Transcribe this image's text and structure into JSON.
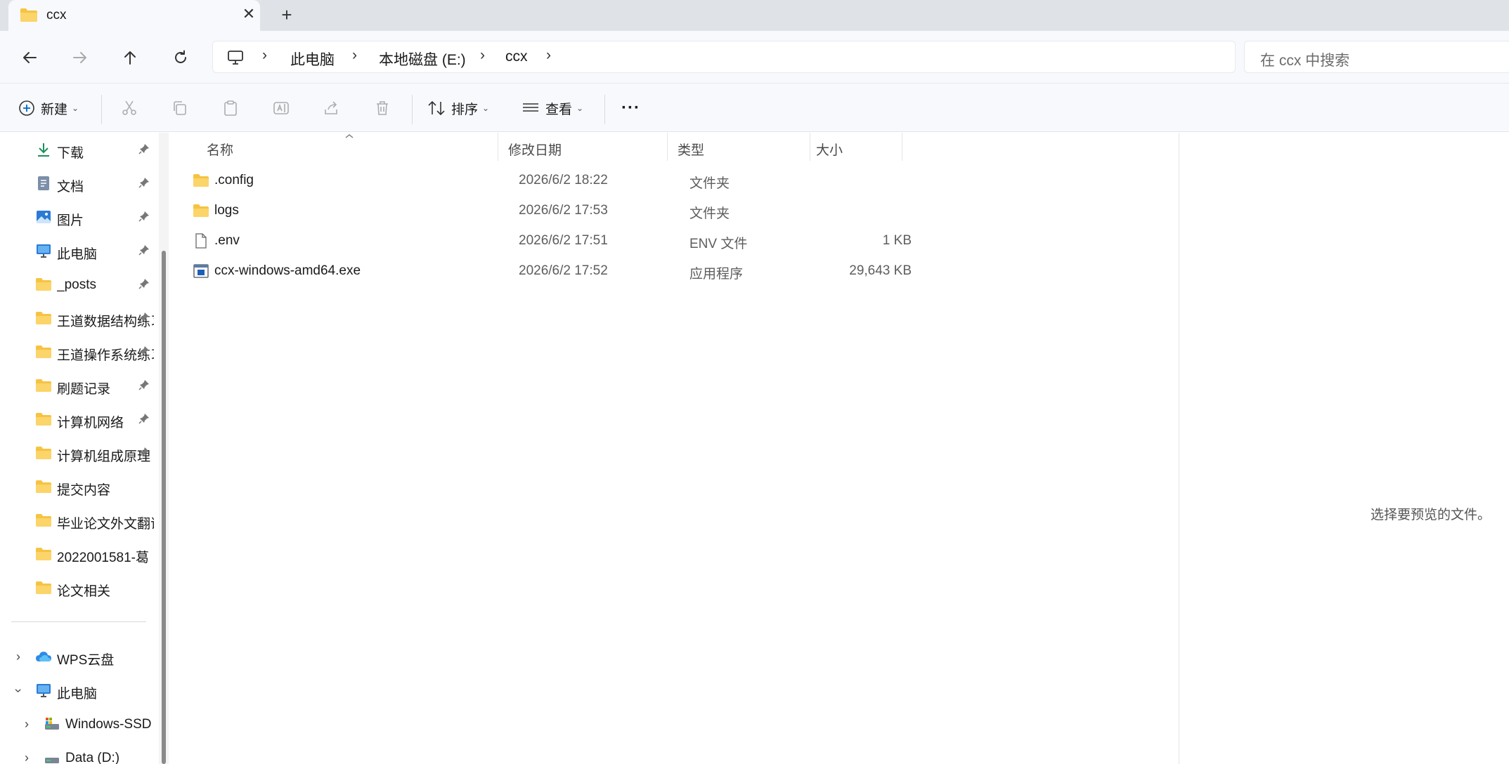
{
  "tab": {
    "title": "ccx",
    "close_glyph": "✕",
    "new_tab_glyph": "+"
  },
  "nav": {
    "back": "back-arrow-icon",
    "forward": "forward-arrow-icon",
    "up": "up-arrow-icon",
    "refresh": "refresh-icon"
  },
  "breadcrumb": {
    "items": [
      "此电脑",
      "本地磁盘 (E:)",
      "ccx"
    ]
  },
  "search": {
    "placeholder": "在 ccx 中搜索"
  },
  "toolbar": {
    "new_label": "新建",
    "sort_label": "排序",
    "view_label": "查看",
    "more_glyph": "···"
  },
  "sidebar": {
    "quick_access": [
      {
        "label": "下载",
        "icon": "download-icon",
        "pinned": true
      },
      {
        "label": "文档",
        "icon": "document-icon",
        "pinned": true
      },
      {
        "label": "图片",
        "icon": "picture-icon",
        "pinned": true
      },
      {
        "label": "此电脑",
        "icon": "computer-icon",
        "pinned": true
      },
      {
        "label": "_posts",
        "icon": "folder-icon",
        "pinned": true
      },
      {
        "label": "王道数据结构练习",
        "icon": "folder-icon",
        "pinned": true
      },
      {
        "label": "王道操作系统练习",
        "icon": "folder-icon",
        "pinned": true
      },
      {
        "label": "刷题记录",
        "icon": "folder-icon",
        "pinned": true
      },
      {
        "label": "计算机网络",
        "icon": "folder-icon",
        "pinned": true
      },
      {
        "label": "计算机组成原理",
        "icon": "folder-icon",
        "pinned": true
      },
      {
        "label": "提交内容",
        "icon": "folder-icon",
        "pinned": false
      },
      {
        "label": "毕业论文外文翻译",
        "icon": "folder-icon",
        "pinned": false
      },
      {
        "label": "2022001581-葛",
        "icon": "folder-icon",
        "pinned": false
      },
      {
        "label": "论文相关",
        "icon": "folder-icon",
        "pinned": false
      }
    ],
    "tree": [
      {
        "label": "WPS云盘",
        "icon": "cloud-icon",
        "expanded": false
      },
      {
        "label": "此电脑",
        "icon": "computer-icon",
        "expanded": true
      },
      {
        "label": "Windows-SSD",
        "icon": "drive-icon",
        "expanded": false
      },
      {
        "label": "Data (D:)",
        "icon": "drive-icon",
        "expanded": false
      }
    ]
  },
  "columns": {
    "name": "名称",
    "date": "修改日期",
    "type": "类型",
    "size": "大小"
  },
  "files": [
    {
      "name": ".config",
      "date": "2026/6/2 18:22",
      "type": "文件夹",
      "size": "",
      "icon": "folder-icon"
    },
    {
      "name": "logs",
      "date": "2026/6/2 17:53",
      "type": "文件夹",
      "size": "",
      "icon": "folder-icon"
    },
    {
      "name": ".env",
      "date": "2026/6/2 17:51",
      "type": "ENV 文件",
      "size": "1 KB",
      "icon": "file-icon"
    },
    {
      "name": "ccx-windows-amd64.exe",
      "date": "2026/6/2 17:52",
      "type": "应用程序",
      "size": "29,643 KB",
      "icon": "exe-icon"
    }
  ],
  "preview": {
    "message": "选择要预览的文件。"
  },
  "colors": {
    "folder": "#f6c342",
    "accent": "#0067c0",
    "titlebar": "#dfe3e8",
    "chrome": "#f7f9fc"
  }
}
